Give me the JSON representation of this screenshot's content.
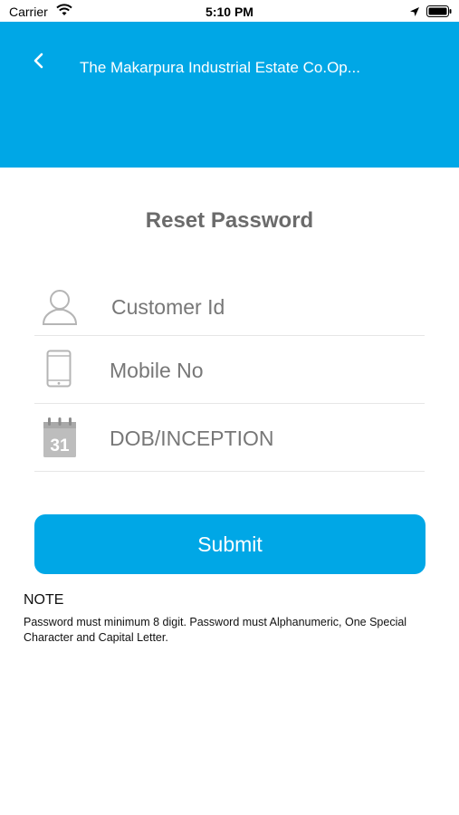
{
  "status_bar": {
    "carrier": "Carrier",
    "time": "5:10 PM",
    "icons": [
      "wifi-icon",
      "location-icon",
      "battery-icon"
    ]
  },
  "header": {
    "title": "The Makarpura Industrial Estate Co.Op...",
    "background_color": "#00a7e6",
    "back_icon": "chevron-left-icon"
  },
  "page": {
    "title": "Reset Password"
  },
  "form": {
    "customer_id": {
      "placeholder": "Customer Id",
      "icon": "user-icon"
    },
    "mobile_no": {
      "placeholder": "Mobile No",
      "icon": "mobile-phone-icon"
    },
    "dob": {
      "placeholder": "DOB/INCEPTION",
      "icon": "calendar-icon",
      "calendar_day": "31"
    },
    "submit_label": "Submit"
  },
  "note": {
    "heading": "NOTE",
    "text": "Password must minimum 8 digit. Password must Alphanumeric, One Special Character and Capital Letter."
  }
}
